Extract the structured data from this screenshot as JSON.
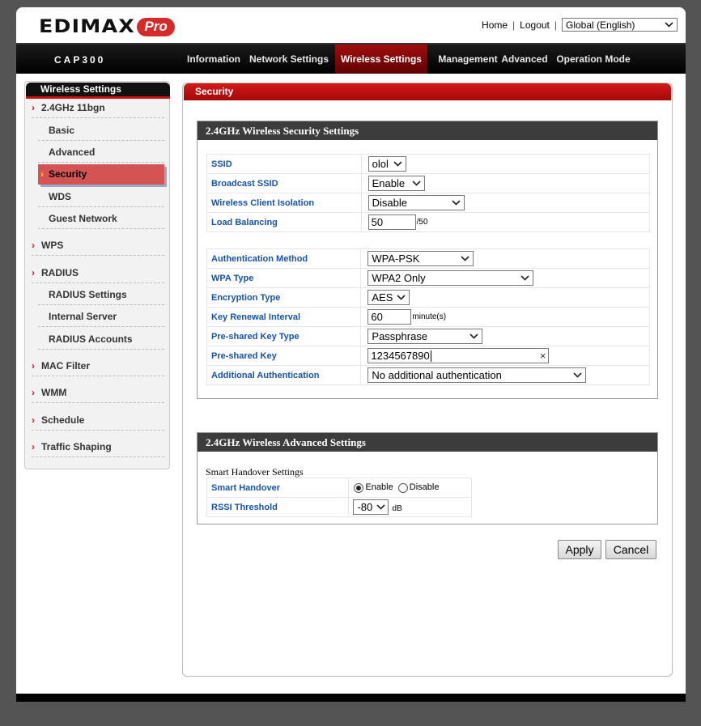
{
  "header": {
    "logo_text": "EDIMAX",
    "logo_badge": "Pro",
    "home_link": "Home",
    "separator": "|",
    "logout_link": "Logout",
    "language_select": "Global (English)"
  },
  "nav": {
    "model": "CAP300",
    "items": [
      {
        "label": "Information"
      },
      {
        "label": "Network Settings"
      },
      {
        "label": "Wireless Settings",
        "active": true
      },
      {
        "label": "Management"
      },
      {
        "label": "Advanced"
      },
      {
        "label": "Operation Mode"
      }
    ]
  },
  "sidebar": {
    "title": "Wireless Settings",
    "items": [
      {
        "label": "2.4GHz 11bgn",
        "level": "top"
      },
      {
        "label": "Basic",
        "level": "sub"
      },
      {
        "label": "Advanced",
        "level": "sub"
      },
      {
        "label": "Security",
        "level": "sub",
        "active": true
      },
      {
        "label": "WDS",
        "level": "sub"
      },
      {
        "label": "Guest Network",
        "level": "sub"
      },
      {
        "label": "WPS",
        "level": "top"
      },
      {
        "label": "RADIUS",
        "level": "top"
      },
      {
        "label": "RADIUS Settings",
        "level": "sub"
      },
      {
        "label": "Internal Server",
        "level": "sub"
      },
      {
        "label": "RADIUS Accounts",
        "level": "sub"
      },
      {
        "label": "MAC Filter",
        "level": "top"
      },
      {
        "label": "WMM",
        "level": "top"
      },
      {
        "label": "Schedule",
        "level": "top"
      },
      {
        "label": "Traffic Shaping",
        "level": "top"
      }
    ]
  },
  "main": {
    "title": "Security",
    "security_section": {
      "title": "2.4GHz Wireless Security Settings",
      "ssid": {
        "label": "SSID",
        "value": "olol"
      },
      "broadcast_ssid": {
        "label": "Broadcast SSID",
        "value": "Enable"
      },
      "client_isolation": {
        "label": "Wireless Client Isolation",
        "value": "Disable"
      },
      "load_balancing": {
        "label": "Load Balancing",
        "value": "50",
        "suffix": "/50"
      },
      "auth_method": {
        "label": "Authentication Method",
        "value": "WPA-PSK"
      },
      "wpa_type": {
        "label": "WPA Type",
        "value": "WPA2 Only"
      },
      "encryption_type": {
        "label": "Encryption Type",
        "value": "AES"
      },
      "key_renewal": {
        "label": "Key Renewal Interval",
        "value": "60",
        "suffix": "minute(s)"
      },
      "psk_type": {
        "label": "Pre-shared Key Type",
        "value": "Passphrase"
      },
      "psk": {
        "label": "Pre-shared Key",
        "value": "1234567890",
        "clear_symbol": "×"
      },
      "additional_auth": {
        "label": "Additional Authentication",
        "value": "No additional authentication"
      }
    },
    "advanced_section": {
      "title": "2.4GHz Wireless Advanced Settings",
      "subtitle": "Smart Handover Settings",
      "smart_handover": {
        "label": "Smart Handover",
        "options": [
          "Enable",
          "Disable"
        ],
        "selected": "Enable"
      },
      "rssi": {
        "label": "RSSI Threshold",
        "value": "-80",
        "suffix": "dB"
      }
    },
    "apply_label": "Apply",
    "cancel_label": "Cancel"
  }
}
